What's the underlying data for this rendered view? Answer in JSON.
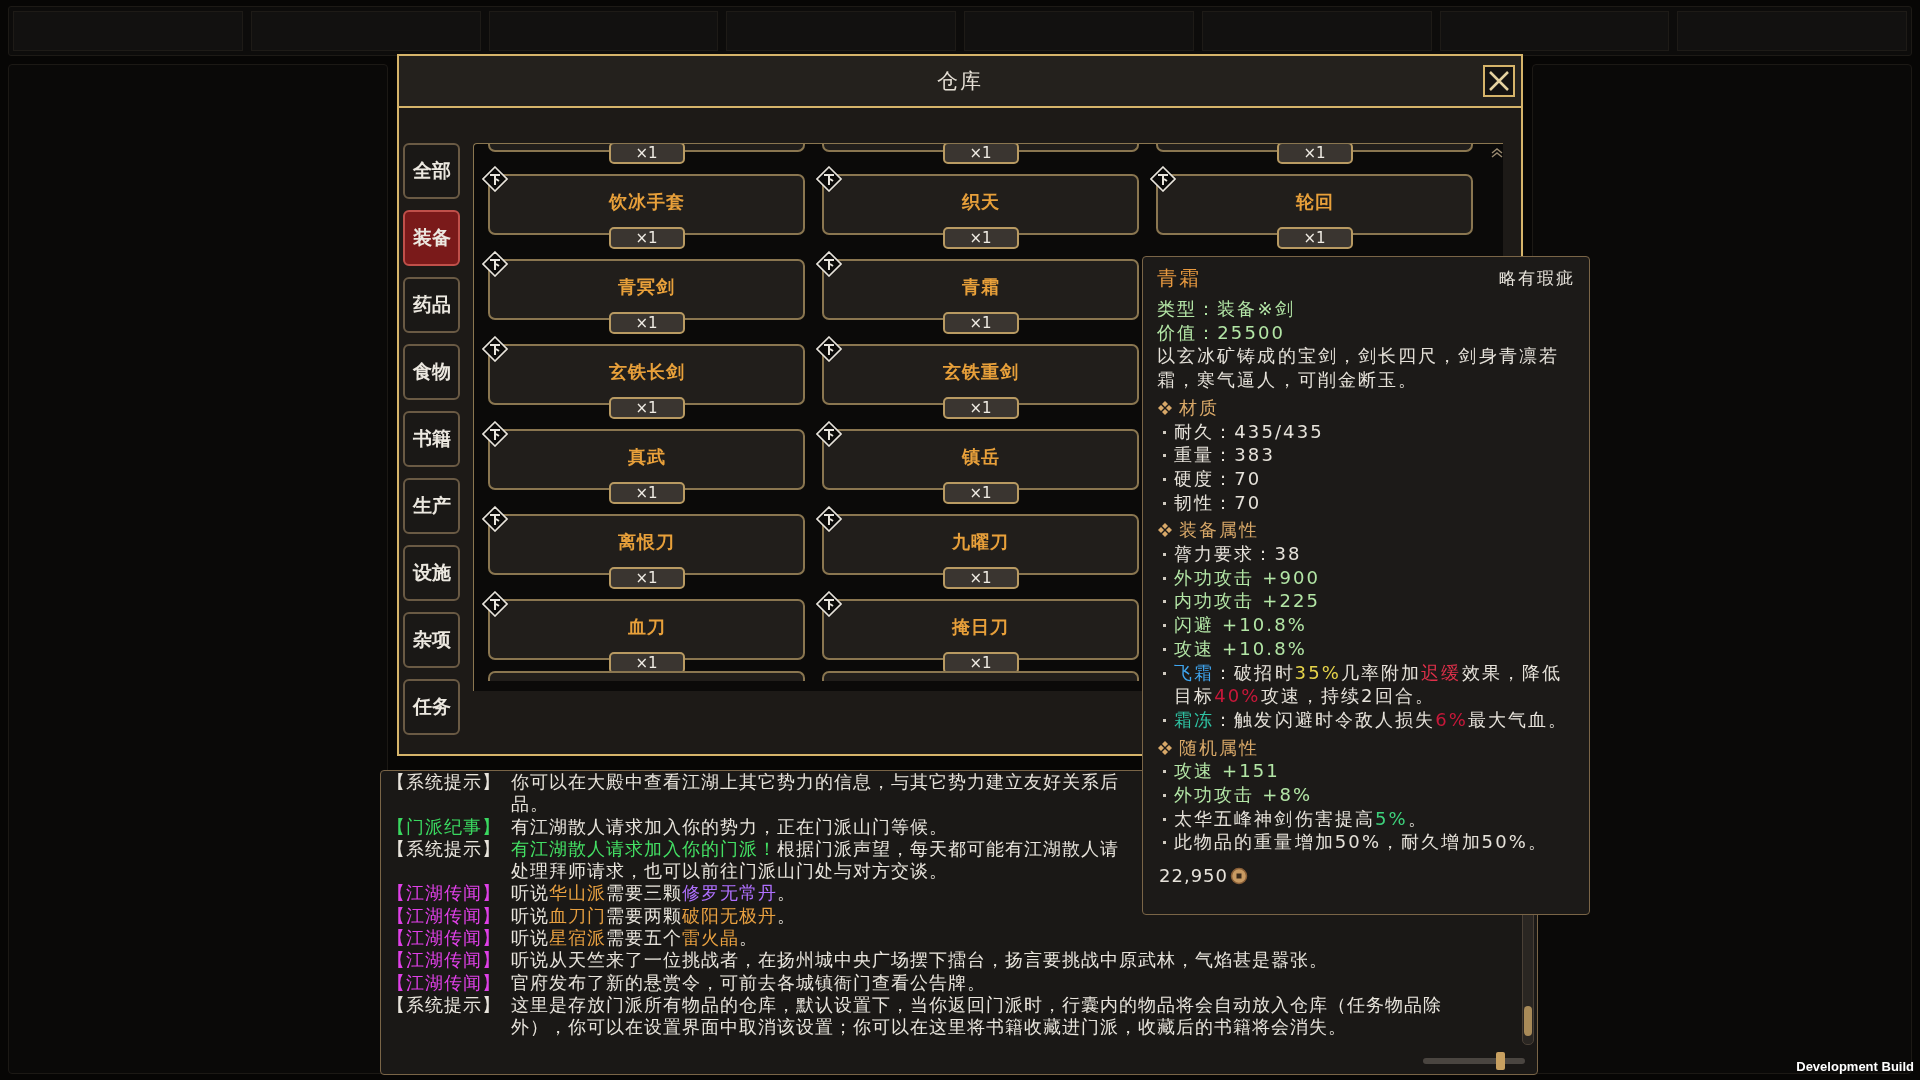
{
  "dialog": {
    "title": "仓库"
  },
  "categories": [
    {
      "label": "全部",
      "selected": false
    },
    {
      "label": "装备",
      "selected": true
    },
    {
      "label": "药品",
      "selected": false
    },
    {
      "label": "食物",
      "selected": false
    },
    {
      "label": "书籍",
      "selected": false
    },
    {
      "label": "生产",
      "selected": false
    },
    {
      "label": "设施",
      "selected": false
    },
    {
      "label": "杂项",
      "selected": false
    },
    {
      "label": "任务",
      "selected": false
    }
  ],
  "columns": [
    [
      {
        "kind": "cut_top",
        "count": "×1"
      },
      {
        "kind": "full",
        "name": "饮冰手套",
        "count": "×1"
      },
      {
        "kind": "full",
        "name": "青冥剑",
        "count": "×1"
      },
      {
        "kind": "full",
        "name": "玄铁长剑",
        "count": "×1"
      },
      {
        "kind": "full",
        "name": "真武",
        "count": "×1"
      },
      {
        "kind": "full",
        "name": "离恨刀",
        "count": "×1"
      },
      {
        "kind": "full",
        "name": "血刀",
        "count": "×1"
      },
      {
        "kind": "cut_bottom"
      }
    ],
    [
      {
        "kind": "cut_top",
        "count": "×1"
      },
      {
        "kind": "full",
        "name": "织天",
        "count": "×1"
      },
      {
        "kind": "full",
        "name": "青霜",
        "count": "×1"
      },
      {
        "kind": "full",
        "name": "玄铁重剑",
        "count": "×1"
      },
      {
        "kind": "full",
        "name": "镇岳",
        "count": "×1"
      },
      {
        "kind": "full",
        "name": "九曜刀",
        "count": "×1"
      },
      {
        "kind": "full",
        "name": "掩日刀",
        "count": "×1"
      },
      {
        "kind": "cut_bottom"
      }
    ],
    [
      {
        "kind": "cut_top",
        "count": "×1"
      },
      {
        "kind": "full",
        "name": "轮回",
        "count": "×1"
      }
    ]
  ],
  "tooltip": {
    "title": "青霜",
    "quality": "略有瑕疵",
    "head_lines": [
      [
        {
          "text": "类型：装备※剑",
          "color": "#b3e6a6"
        }
      ],
      [
        {
          "text": "价值：25500",
          "color": "#b3e6a6"
        }
      ]
    ],
    "description": "以玄冰矿铸成的宝剑，剑长四尺，剑身青凛若霜，寒气逼人，可削金断玉。",
    "sections": [
      {
        "title": "材质",
        "entries": [
          [
            {
              "text": "耐久：435/435"
            }
          ],
          [
            {
              "text": "重量：383"
            }
          ],
          [
            {
              "text": "硬度：70"
            }
          ],
          [
            {
              "text": "韧性：70"
            }
          ]
        ]
      },
      {
        "title": "装备属性",
        "entries": [
          [
            {
              "text": "膂力要求：38"
            }
          ],
          [
            {
              "text": "外功攻击 +900",
              "color": "#b3e6a6"
            }
          ],
          [
            {
              "text": "内功攻击 +225",
              "color": "#b3e6a6"
            }
          ],
          [
            {
              "text": "闪避 +10.8%",
              "color": "#b3e6a6"
            }
          ],
          [
            {
              "text": "攻速 +10.8%",
              "color": "#b3e6a6"
            }
          ],
          [
            {
              "text": "飞霜",
              "color": "#3fa6f0"
            },
            {
              "text": "：破招时"
            },
            {
              "text": "35%",
              "color": "#e6d44a"
            },
            {
              "text": "几率附加"
            },
            {
              "text": "迟缓",
              "color": "#e0304a"
            },
            {
              "text": "效果，降低目标"
            },
            {
              "text": "40%",
              "color": "#c8183a"
            },
            {
              "text": "攻速，持续2回合。"
            }
          ],
          [
            {
              "text": "霜冻",
              "color": "#2fc4a4"
            },
            {
              "text": "：触发闪避时令敌人损失"
            },
            {
              "text": "6%",
              "color": "#c8183a"
            },
            {
              "text": "最大气血。"
            }
          ]
        ]
      },
      {
        "title": "随机属性",
        "entries": [
          [
            {
              "text": "攻速 +151",
              "color": "#b3e6a6"
            }
          ],
          [
            {
              "text": "外功攻击 +8%",
              "color": "#b3e6a6"
            }
          ],
          [
            {
              "text": "太华五峰神剑伤害提高"
            },
            {
              "text": "5%",
              "color": "#3ed27c"
            },
            {
              "text": "。"
            }
          ],
          [
            {
              "text": "此物品的重量增加50%，耐久增加50%。"
            }
          ]
        ]
      }
    ],
    "price": "22,950"
  },
  "log": {
    "messages": [
      {
        "tag": {
          "text": "【系统提示】",
          "color": "#e8e4dc"
        },
        "lines": [
          [
            {
              "text": "你可以在大殿中查看江湖上其它势力的信息，与其它势力建立友好关系后"
            }
          ],
          [
            {
              "text": "品。"
            }
          ]
        ]
      },
      {
        "tag": {
          "text": "【门派纪事】",
          "color": "#3ad860"
        },
        "lines": [
          [
            {
              "text": "有江湖散人请求加入你的势力，正在门派山门等候。"
            }
          ]
        ]
      },
      {
        "tag": {
          "text": "【系统提示】",
          "color": "#e8e4dc"
        },
        "lines": [
          [
            {
              "text": "有江湖散人请求加入你的门派！",
              "color": "#44e064"
            },
            {
              "text": "根据门派声望，每天都可能有江湖散人请"
            }
          ],
          [
            {
              "text": "处理拜师请求，也可以前往门派山门处与对方交谈。"
            }
          ]
        ]
      },
      {
        "tag": {
          "text": "【江湖传闻】",
          "color": "#e040e8"
        },
        "lines": [
          [
            {
              "text": "听说"
            },
            {
              "text": "华山派",
              "color": "#e8a040"
            },
            {
              "text": "需要三颗"
            },
            {
              "text": "修罗无常丹",
              "color": "#b070ff"
            },
            {
              "text": "。"
            }
          ]
        ]
      },
      {
        "tag": {
          "text": "【江湖传闻】",
          "color": "#e040e8"
        },
        "lines": [
          [
            {
              "text": "听说"
            },
            {
              "text": "血刀门",
              "color": "#e8a040"
            },
            {
              "text": "需要两颗"
            },
            {
              "text": "破阳无极丹",
              "color": "#e8a040"
            },
            {
              "text": "。"
            }
          ]
        ]
      },
      {
        "tag": {
          "text": "【江湖传闻】",
          "color": "#e040e8"
        },
        "lines": [
          [
            {
              "text": "听说"
            },
            {
              "text": "星宿派",
              "color": "#e8a040"
            },
            {
              "text": "需要五个"
            },
            {
              "text": "雷火晶",
              "color": "#e8a040"
            },
            {
              "text": "。"
            }
          ]
        ]
      },
      {
        "tag": {
          "text": "【江湖传闻】",
          "color": "#e040e8"
        },
        "lines": [
          [
            {
              "text": "听说从天竺来了一位挑战者，在扬州城中央广场摆下擂台，扬言要挑战中原武林，气焰甚是嚣张。"
            }
          ]
        ]
      },
      {
        "tag": {
          "text": "【江湖传闻】",
          "color": "#e040e8"
        },
        "lines": [
          [
            {
              "text": "官府发布了新的悬赏令，可前去各城镇衙门查看公告牌。"
            }
          ]
        ]
      },
      {
        "tag": {
          "text": "【系统提示】",
          "color": "#e8e4dc"
        },
        "lines": [
          [
            {
              "text": "这里是存放门派所有物品的仓库，默认设置下，当你返回门派时，行囊内的物品将会自动放入仓库（任务物品除"
            }
          ],
          [
            {
              "text": "外），你可以在设置界面中取消该设置；你可以在这里将书籍收藏进门派，收藏后的书籍将会消失。"
            }
          ]
        ]
      }
    ]
  },
  "slider": {
    "level": 0.75
  },
  "build_label": "Development Build"
}
